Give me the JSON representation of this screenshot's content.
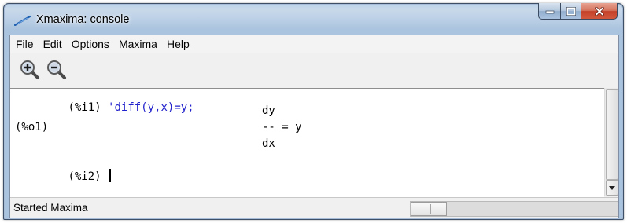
{
  "window": {
    "title": "Xmaxima: console",
    "icons": {
      "app": "feather-icon",
      "minimize": "minimize-icon",
      "maximize": "maximize-icon",
      "close": "close-icon"
    }
  },
  "menubar": {
    "items": [
      "File",
      "Edit",
      "Options",
      "Maxima",
      "Help"
    ]
  },
  "toolbar": {
    "buttons": [
      {
        "name": "zoom-in",
        "icon": "magnifier-plus-icon"
      },
      {
        "name": "zoom-out",
        "icon": "magnifier-minus-icon"
      }
    ]
  },
  "console": {
    "input1": {
      "prompt": "(%i1)",
      "code": "'diff(y,x)=y;"
    },
    "output1": {
      "prompt": "(%o1)",
      "numerator": "dy",
      "equation": "-- = y",
      "denominator": "dx"
    },
    "input2": {
      "prompt": "(%i2)",
      "code": ""
    }
  },
  "statusbar": {
    "text": "Started Maxima"
  },
  "colors": {
    "input_text": "#2222cc",
    "close_button": "#c4422a",
    "title_bar": "#b9d1ea"
  }
}
